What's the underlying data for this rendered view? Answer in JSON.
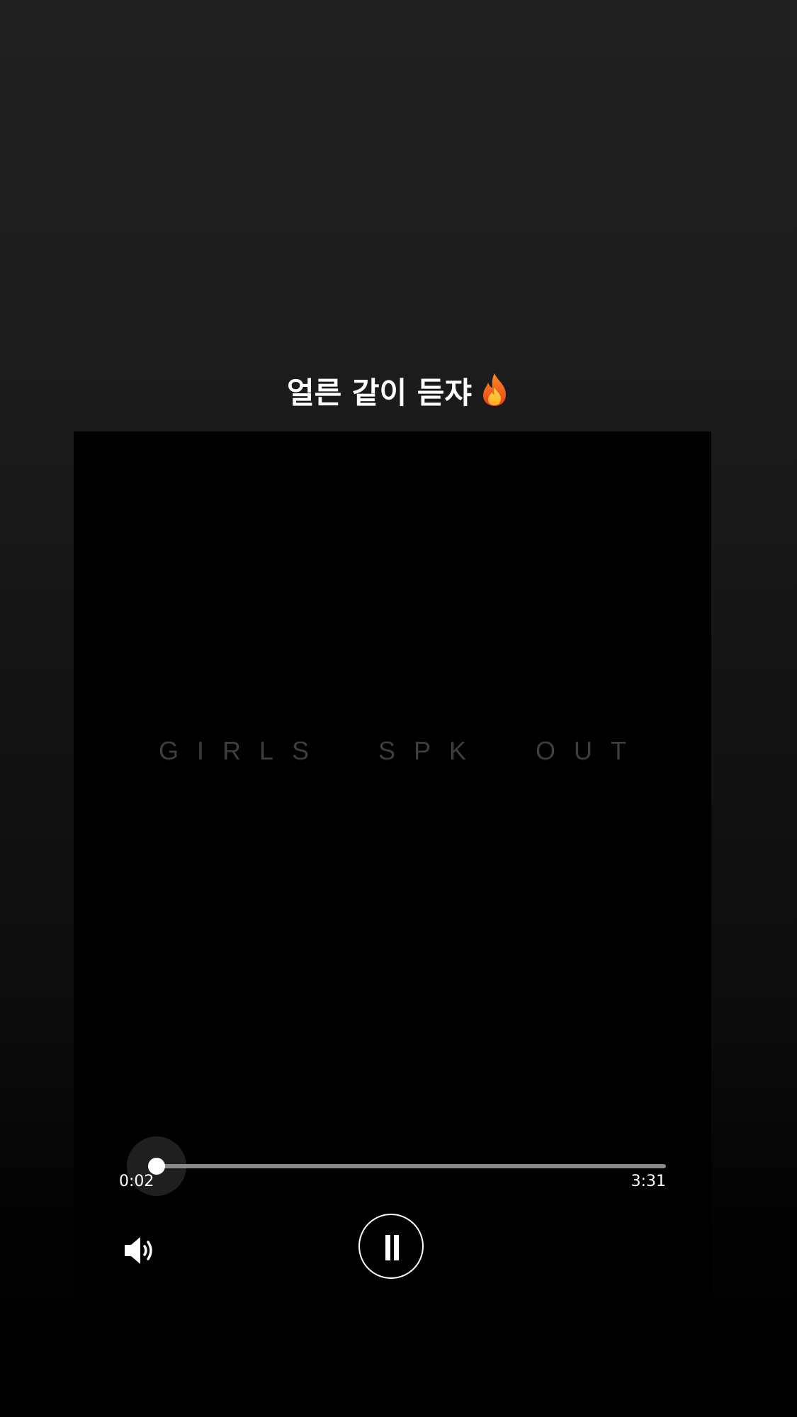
{
  "caption": {
    "text": "얼른 같이 듣쟈",
    "emoji": "🔥"
  },
  "player": {
    "cover_text": "GIRLS  SPK  OUT",
    "progress_fraction": 0.01,
    "current_time": "0:02",
    "total_time": "3:31",
    "volume_icon": "volume-icon",
    "pause_icon": "pause-icon",
    "state": "playing"
  },
  "colors": {
    "background_top": "#202020",
    "background_bottom": "#000000",
    "player_bg": "#000000",
    "track": "#8a8a8a",
    "cover_text": "#3d3d3d"
  }
}
